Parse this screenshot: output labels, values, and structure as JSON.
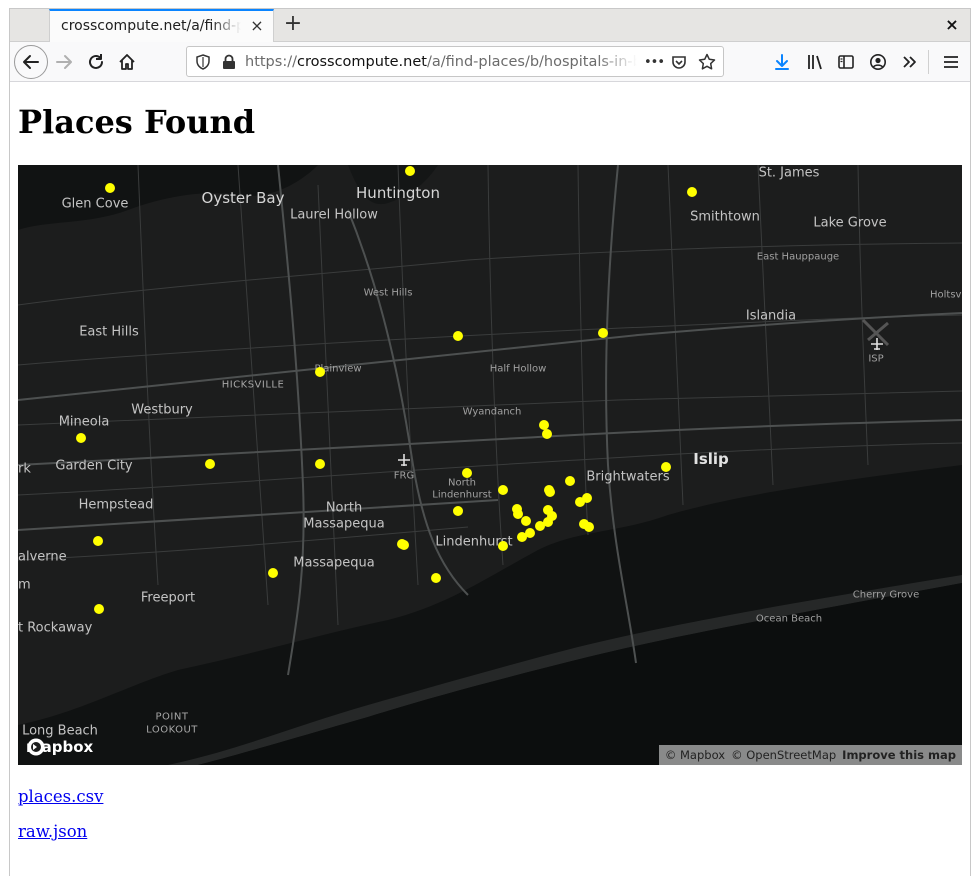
{
  "browser": {
    "tab_title": "crosscompute.net/a/find-places/b/hospitals-in-babylon",
    "tab_close": "×",
    "new_tab": "+",
    "window_close": "×",
    "url_scheme": "https://",
    "url_host": "crosscompute.net",
    "url_path": "/a/find-places/b/hospitals-in-babylon",
    "more_actions": "•••"
  },
  "page": {
    "title": "Places Found",
    "links": [
      {
        "label": "places.csv"
      },
      {
        "label": "raw.json"
      }
    ]
  },
  "map": {
    "labels": [
      {
        "text": "Oyster Bay",
        "cls": "ml-big"
      },
      {
        "text": "Huntington",
        "cls": "ml-big"
      },
      {
        "text": "Glen Cove",
        "cls": "ml-mid"
      },
      {
        "text": "Laurel Hollow",
        "cls": "ml-mid"
      },
      {
        "text": "St. James",
        "cls": "ml-mid"
      },
      {
        "text": "Smithtown",
        "cls": "ml-mid"
      },
      {
        "text": "Lake Grove",
        "cls": "ml-mid"
      },
      {
        "text": "East Hauppauge",
        "cls": "ml-tiny"
      },
      {
        "text": "Holtsvil",
        "cls": "ml-tiny"
      },
      {
        "text": "West Hills",
        "cls": "ml-tiny"
      },
      {
        "text": "Islandia",
        "cls": "ml-mid"
      },
      {
        "text": "East Hills",
        "cls": "ml-mid"
      },
      {
        "text": "HICKSVILLE",
        "cls": "ml-small"
      },
      {
        "text": "Plainview",
        "cls": "ml-tiny"
      },
      {
        "text": "Half Hollow",
        "cls": "ml-tiny"
      },
      {
        "text": "ISP",
        "cls": "ml-tiny"
      },
      {
        "text": "Mineola",
        "cls": "ml-mid"
      },
      {
        "text": "Westbury",
        "cls": "ml-mid"
      },
      {
        "text": "Wyandanch",
        "cls": "ml-tiny"
      },
      {
        "text": "Garden City",
        "cls": "ml-mid"
      },
      {
        "text": "FRG",
        "cls": "ml-tiny"
      },
      {
        "text": "Islip",
        "cls": "ml-bold"
      },
      {
        "text": "Brightwaters",
        "cls": "ml-mid"
      },
      {
        "text": "North",
        "cls": "ml-tiny"
      },
      {
        "text": "Lindenhurst",
        "cls": "ml-tiny"
      },
      {
        "text": "Hempstead",
        "cls": "ml-mid"
      },
      {
        "text": "North",
        "cls": "ml-mid"
      },
      {
        "text": "Massapequa",
        "cls": "ml-mid"
      },
      {
        "text": "Lindenhurst",
        "cls": "ml-mid"
      },
      {
        "text": "alverne",
        "cls": "ml-mid"
      },
      {
        "text": "Massapequa",
        "cls": "ml-mid"
      },
      {
        "text": "Freeport",
        "cls": "ml-mid"
      },
      {
        "text": "Cherry Grove",
        "cls": "ml-tiny"
      },
      {
        "text": "Ocean Beach",
        "cls": "ml-tiny"
      },
      {
        "text": "t Rockaway",
        "cls": "ml-mid"
      },
      {
        "text": "POINT",
        "cls": "ml-small"
      },
      {
        "text": "LOOKOUT",
        "cls": "ml-small"
      },
      {
        "text": "Long Beach",
        "cls": "ml-mid"
      },
      {
        "text": "rk",
        "cls": "ml-mid"
      },
      {
        "text": "m",
        "cls": "ml-mid"
      }
    ],
    "marker_color": "#ffff00",
    "marker_count": 37,
    "logo_text": "mapbox",
    "attribution": {
      "mapbox": "© Mapbox",
      "osm": "© OpenStreetMap",
      "improve": "Improve this map"
    }
  },
  "icons": {
    "back": "back-arrow-icon",
    "forward": "forward-arrow-icon",
    "reload": "reload-icon",
    "home": "home-icon",
    "shield": "shield-icon",
    "lock": "lock-icon",
    "pocket": "pocket-icon",
    "bookmark": "star-icon",
    "download": "download-icon",
    "library": "library-icon",
    "sidebar": "sidebar-icon",
    "account": "account-icon",
    "overflow": "chevrons-icon",
    "menu": "hamburger-icon",
    "airport": "airport-icon"
  }
}
